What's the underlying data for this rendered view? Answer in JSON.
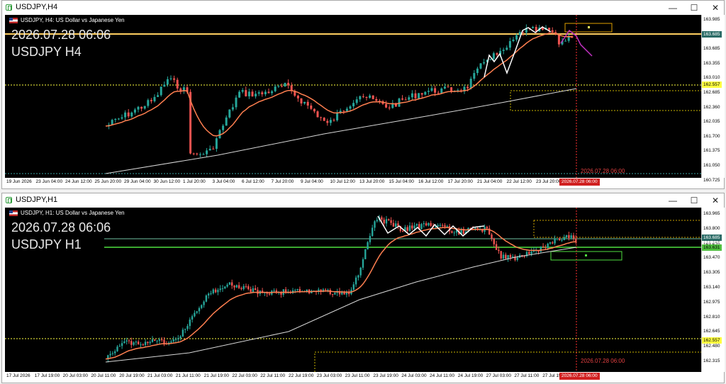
{
  "windows": [
    {
      "title": "USDJPY,H4",
      "sym_desc": "USDJPY, H4: US Dollar vs Japanese Yen",
      "overlay_date": "2026.07.28 06:06",
      "overlay_symbol": "USDJPY H4",
      "cursor_label": "2026.07.28 06:00",
      "prices": [
        "163.985",
        "163.860",
        "163.685",
        "163.355",
        "163.010",
        "162.685",
        "162.360",
        "162.035",
        "161.700",
        "161.375",
        "161.050",
        "160.725"
      ],
      "price_tags": [
        {
          "text": "163.685",
          "bg": "#2a6b66",
          "fg": "#ffffff"
        },
        {
          "text": "162.557",
          "bg": "#ffff40",
          "fg": "#000000"
        }
      ],
      "times": [
        "19 Jun 2026",
        "23 Jun 04:00",
        "24 Jun 12:00",
        "25 Jun 20:00",
        "29 Jun 04:00",
        "30 Jun 12:00",
        "1 Jul 20:00",
        "3 Jul 04:00",
        "6 Jul 12:00",
        "7 Jul 20:00",
        "9 Jul 04:00",
        "10 Jul 12:00",
        "13 Jul 20:00",
        "15 Jul 04:00",
        "16 Jul 12:00",
        "17 Jul 20:00",
        "21 Jul 04:00",
        "22 Jul 12:00",
        "23 Jul 20:00"
      ],
      "time_cursor": "2026.07.28 06:00"
    },
    {
      "title": "USDJPY,H1",
      "sym_desc": "USDJPY, H1: US Dollar vs Japanese Yen",
      "overlay_date": "2026.07.28 06:06",
      "overlay_symbol": "USDJPY H1",
      "cursor_label": "2026.07.28 06:00",
      "prices": [
        "163.965",
        "163.800",
        "163.635",
        "163.470",
        "163.305",
        "163.140",
        "162.975",
        "162.810",
        "162.645",
        "162.480",
        "162.315"
      ],
      "price_tags": [
        {
          "text": "163.685",
          "bg": "#2a6b66",
          "fg": "#ffffff"
        },
        {
          "text": "163.670",
          "bg": "#ffffff",
          "fg": "#000000"
        },
        {
          "text": "163.631",
          "bg": "#50c040",
          "fg": "#000000"
        },
        {
          "text": "162.557",
          "bg": "#ffff40",
          "fg": "#000000"
        }
      ],
      "times": [
        "17 Jul 2026",
        "17 Jul 19:00",
        "20 Jul 03:00",
        "20 Jul 11:00",
        "20 Jul 19:00",
        "21 Jul 03:00",
        "21 Jul 11:00",
        "21 Jul 19:00",
        "22 Jul 03:00",
        "22 Jul 11:00",
        "22 Jul 19:00",
        "23 Jul 03:00",
        "23 Jul 11:00",
        "23 Jul 19:00",
        "24 Jul 03:00",
        "24 Jul 11:00",
        "24 Jul 19:00",
        "27 Jul 03:00",
        "27 Jul 11:00",
        "27 Jul 19:00"
      ],
      "time_cursor": "2026.07.28 06:00"
    }
  ],
  "window_buttons": {
    "minimize": "—",
    "maximize": "☐",
    "close": "✕"
  },
  "icons": {
    "window": "chart-window-icon",
    "flag": "us-flag-icon"
  },
  "colors": {
    "bull": "#26a69a",
    "bear": "#ef5350",
    "ma_fast": "#ff7f50",
    "ma_slow": "#d8d8d8",
    "zigzag": "#ffffff",
    "cursor": "#ff3030",
    "level_yellow": "#ffff40",
    "level_orange": "#ffa500",
    "level_green": "#50e040",
    "projection": "#c030c0"
  }
}
